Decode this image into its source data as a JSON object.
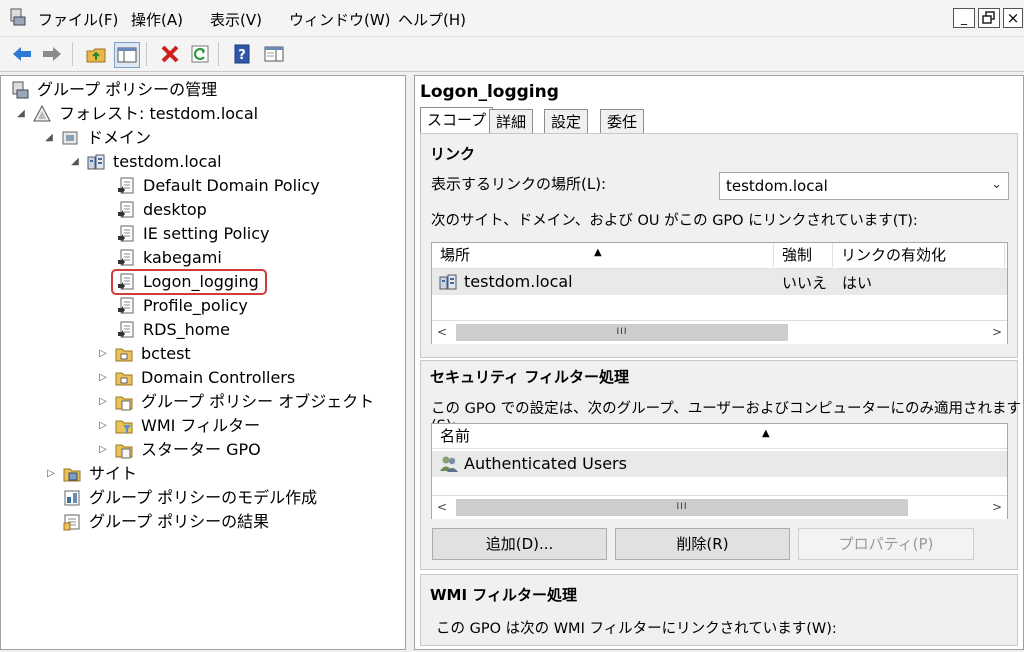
{
  "menu": {
    "items": [
      "ファイル(F)",
      "操作(A)",
      "表示(V)",
      "ウィンドウ(W)",
      "ヘルプ(H)"
    ],
    "window_buttons": {
      "minimize": "_",
      "restore": "🗗",
      "close": "×"
    }
  },
  "toolbar": {
    "buttons": [
      "back-arrow-icon",
      "forward-arrow-icon",
      "up-folder-icon",
      "show-hide-tree-icon",
      "delete-icon",
      "refresh-icon",
      "help-icon",
      "properties-icon"
    ]
  },
  "tree": {
    "root": "グループ ポリシーの管理",
    "forest": "フォレスト: testdom.local",
    "domains": "ドメイン",
    "domain": "testdom.local",
    "gpos": [
      "Default Domain Policy",
      "desktop",
      "IE setting Policy",
      "kabegami",
      "Logon_logging",
      "Profile_policy",
      "RDS_home"
    ],
    "selected": "Logon_logging",
    "containers": [
      "bctest",
      "Domain Controllers",
      "グループ ポリシー オブジェクト",
      "WMI フィルター",
      "スターター GPO"
    ],
    "sites": "サイト",
    "modeling": "グループ ポリシーのモデル作成",
    "results": "グループ ポリシーの結果"
  },
  "details": {
    "title": "Logon_logging",
    "tabs": [
      "スコープ",
      "詳細",
      "設定",
      "委任"
    ],
    "active_tab": "スコープ",
    "links": {
      "heading": "リンク",
      "location_label": "表示するリンクの場所(L):",
      "location_value": "testdom.local",
      "description": "次のサイト、ドメイン、および OU がこの GPO にリンクされています(T):",
      "columns": [
        "場所",
        "強制",
        "リンクの有効化"
      ],
      "rows": [
        {
          "location": "testdom.local",
          "enforced": "いいえ",
          "enabled": "はい"
        }
      ],
      "scroll_thumb": "III"
    },
    "security": {
      "heading": "セキュリティ フィルター処理",
      "description": "この GPO での設定は、次のグループ、ユーザーおよびコンピューターにのみ適用されます(S):",
      "column": "名前",
      "rows": [
        "Authenticated Users"
      ],
      "scroll_thumb": "III",
      "buttons": {
        "add": "追加(D)...",
        "remove": "削除(R)",
        "properties": "プロパティ(P)"
      }
    },
    "wmi": {
      "heading": "WMI フィルター処理",
      "description": "この GPO は次の WMI フィルターにリンクされています(W):"
    }
  }
}
